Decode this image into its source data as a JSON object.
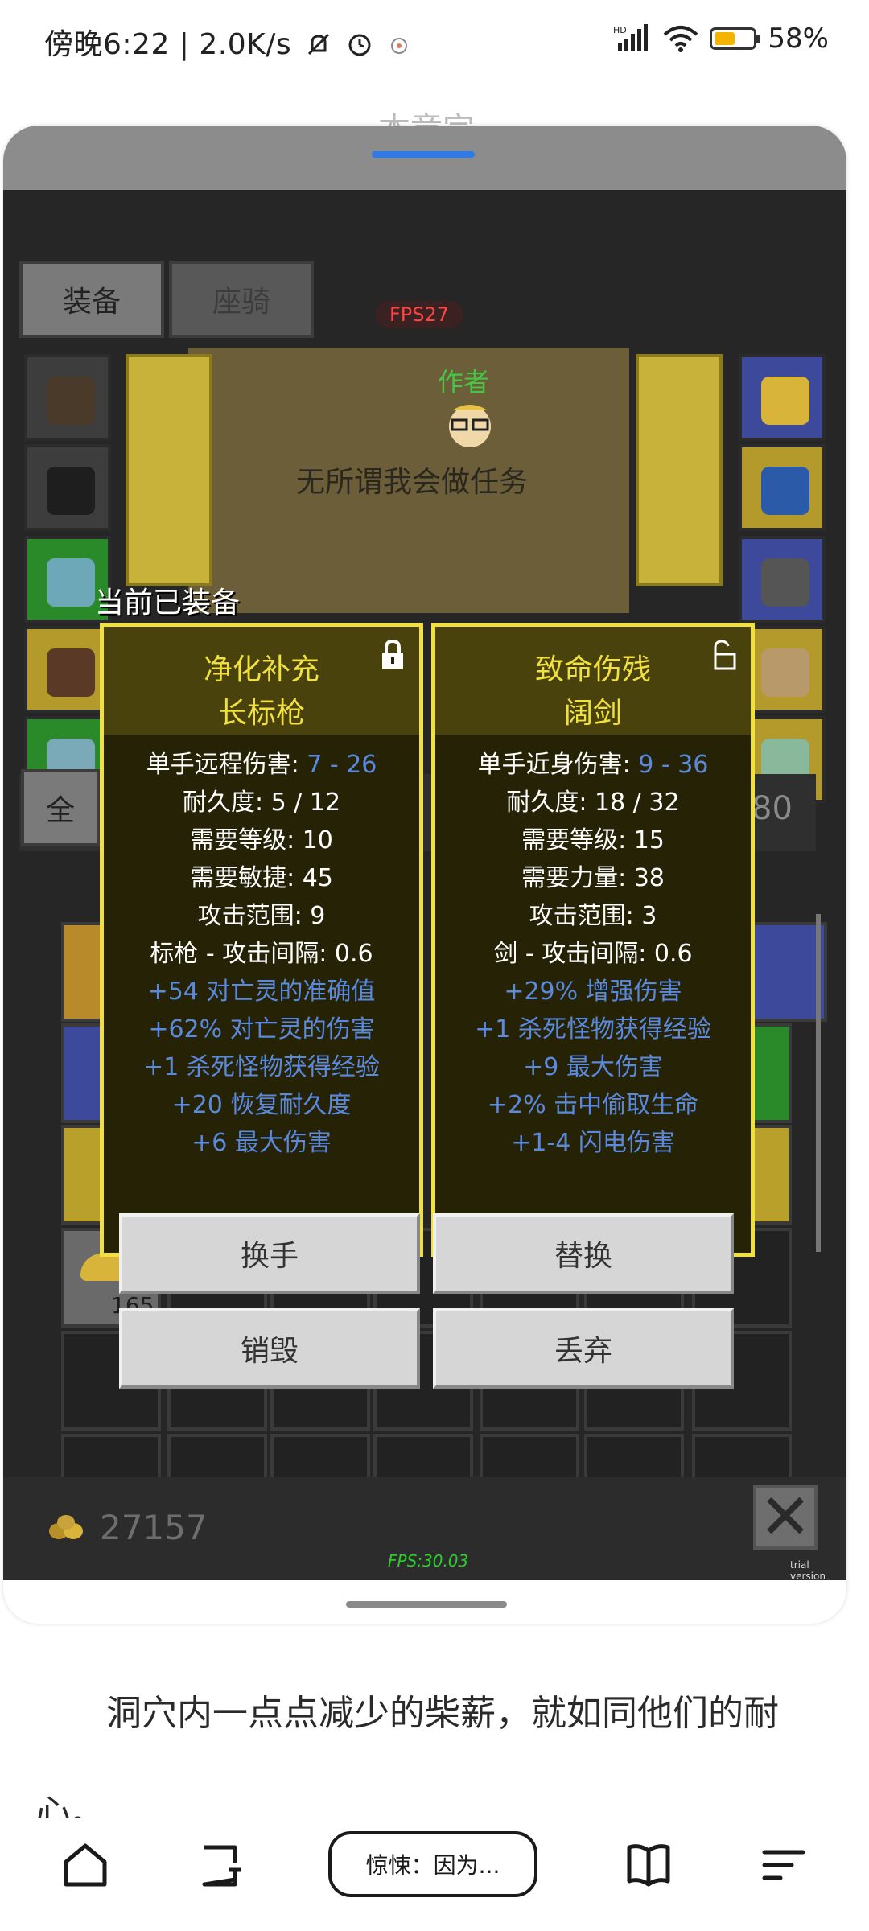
{
  "status_bar": {
    "time_speed": "傍晚6:22 | 2.0K/s",
    "battery": "58%",
    "battery_level": 0.58,
    "icons": [
      "mute-bell-icon",
      "alarm-icon",
      "app-notification-icon",
      "signal-icon",
      "wifi-icon",
      "battery-icon"
    ]
  },
  "reader": {
    "chapter_title": "本章完",
    "paragraph": "洞穴内一点点减少的柴薪，就如同他们的耐心。"
  },
  "game": {
    "tabs": [
      "装备",
      "座骑"
    ],
    "fps_badge": "FPS27",
    "author_label": "作者",
    "npc_text": "无所谓我会做任务",
    "inventory_tab": "全",
    "slot_count": "80",
    "stack_count": "165",
    "gold": "27157",
    "fps_bottom": "FPS:30.03",
    "trial_label": "trial version",
    "equipped_label": "当前已装备",
    "close_label": "✕"
  },
  "item_left": {
    "name1": "净化补充",
    "name2": "长标枪",
    "lock_icon": "lock-closed-icon",
    "stats": [
      {
        "label": "单手远程伤害: ",
        "value": "7 - 26"
      },
      {
        "label": "耐久度: 5 / 12",
        "value": ""
      },
      {
        "label": "需要等级: 10",
        "value": ""
      },
      {
        "label": "需要敏捷: 45",
        "value": ""
      },
      {
        "label": "攻击范围: 9",
        "value": ""
      },
      {
        "label": "标枪 - 攻击间隔: 0.6",
        "value": ""
      }
    ],
    "bonuses": [
      "+54 对亡灵的准确值",
      "+62% 对亡灵的伤害",
      "+1 杀死怪物获得经验",
      "+20 恢复耐久度",
      "+6 最大伤害"
    ]
  },
  "item_right": {
    "name1": "致命伤残",
    "name2": "阔剑",
    "lock_icon": "lock-open-icon",
    "stats": [
      {
        "label": "单手近身伤害: ",
        "value": "9 - 36"
      },
      {
        "label": "耐久度: 18 / 32",
        "value": ""
      },
      {
        "label": "需要等级: 15",
        "value": ""
      },
      {
        "label": "需要力量: 38",
        "value": ""
      },
      {
        "label": "攻击范围: 3",
        "value": ""
      },
      {
        "label": "剑 - 攻击间隔: 0.6",
        "value": ""
      }
    ],
    "bonuses": [
      "+29% 增强伤害",
      "+1 杀死怪物获得经验",
      "+9 最大伤害",
      "+2% 击中偷取生命",
      "+1-4 闪电伤害"
    ]
  },
  "actions": {
    "swap_hand": "换手",
    "replace": "替换",
    "destroy": "销毁",
    "drop": "丢弃"
  },
  "bottom_nav": {
    "home_icon": "home-icon",
    "notes_icon": "notes-icon",
    "chapter_pill": "惊悚：因为...",
    "book_icon": "book-icon",
    "menu_icon": "menu-icon"
  }
}
